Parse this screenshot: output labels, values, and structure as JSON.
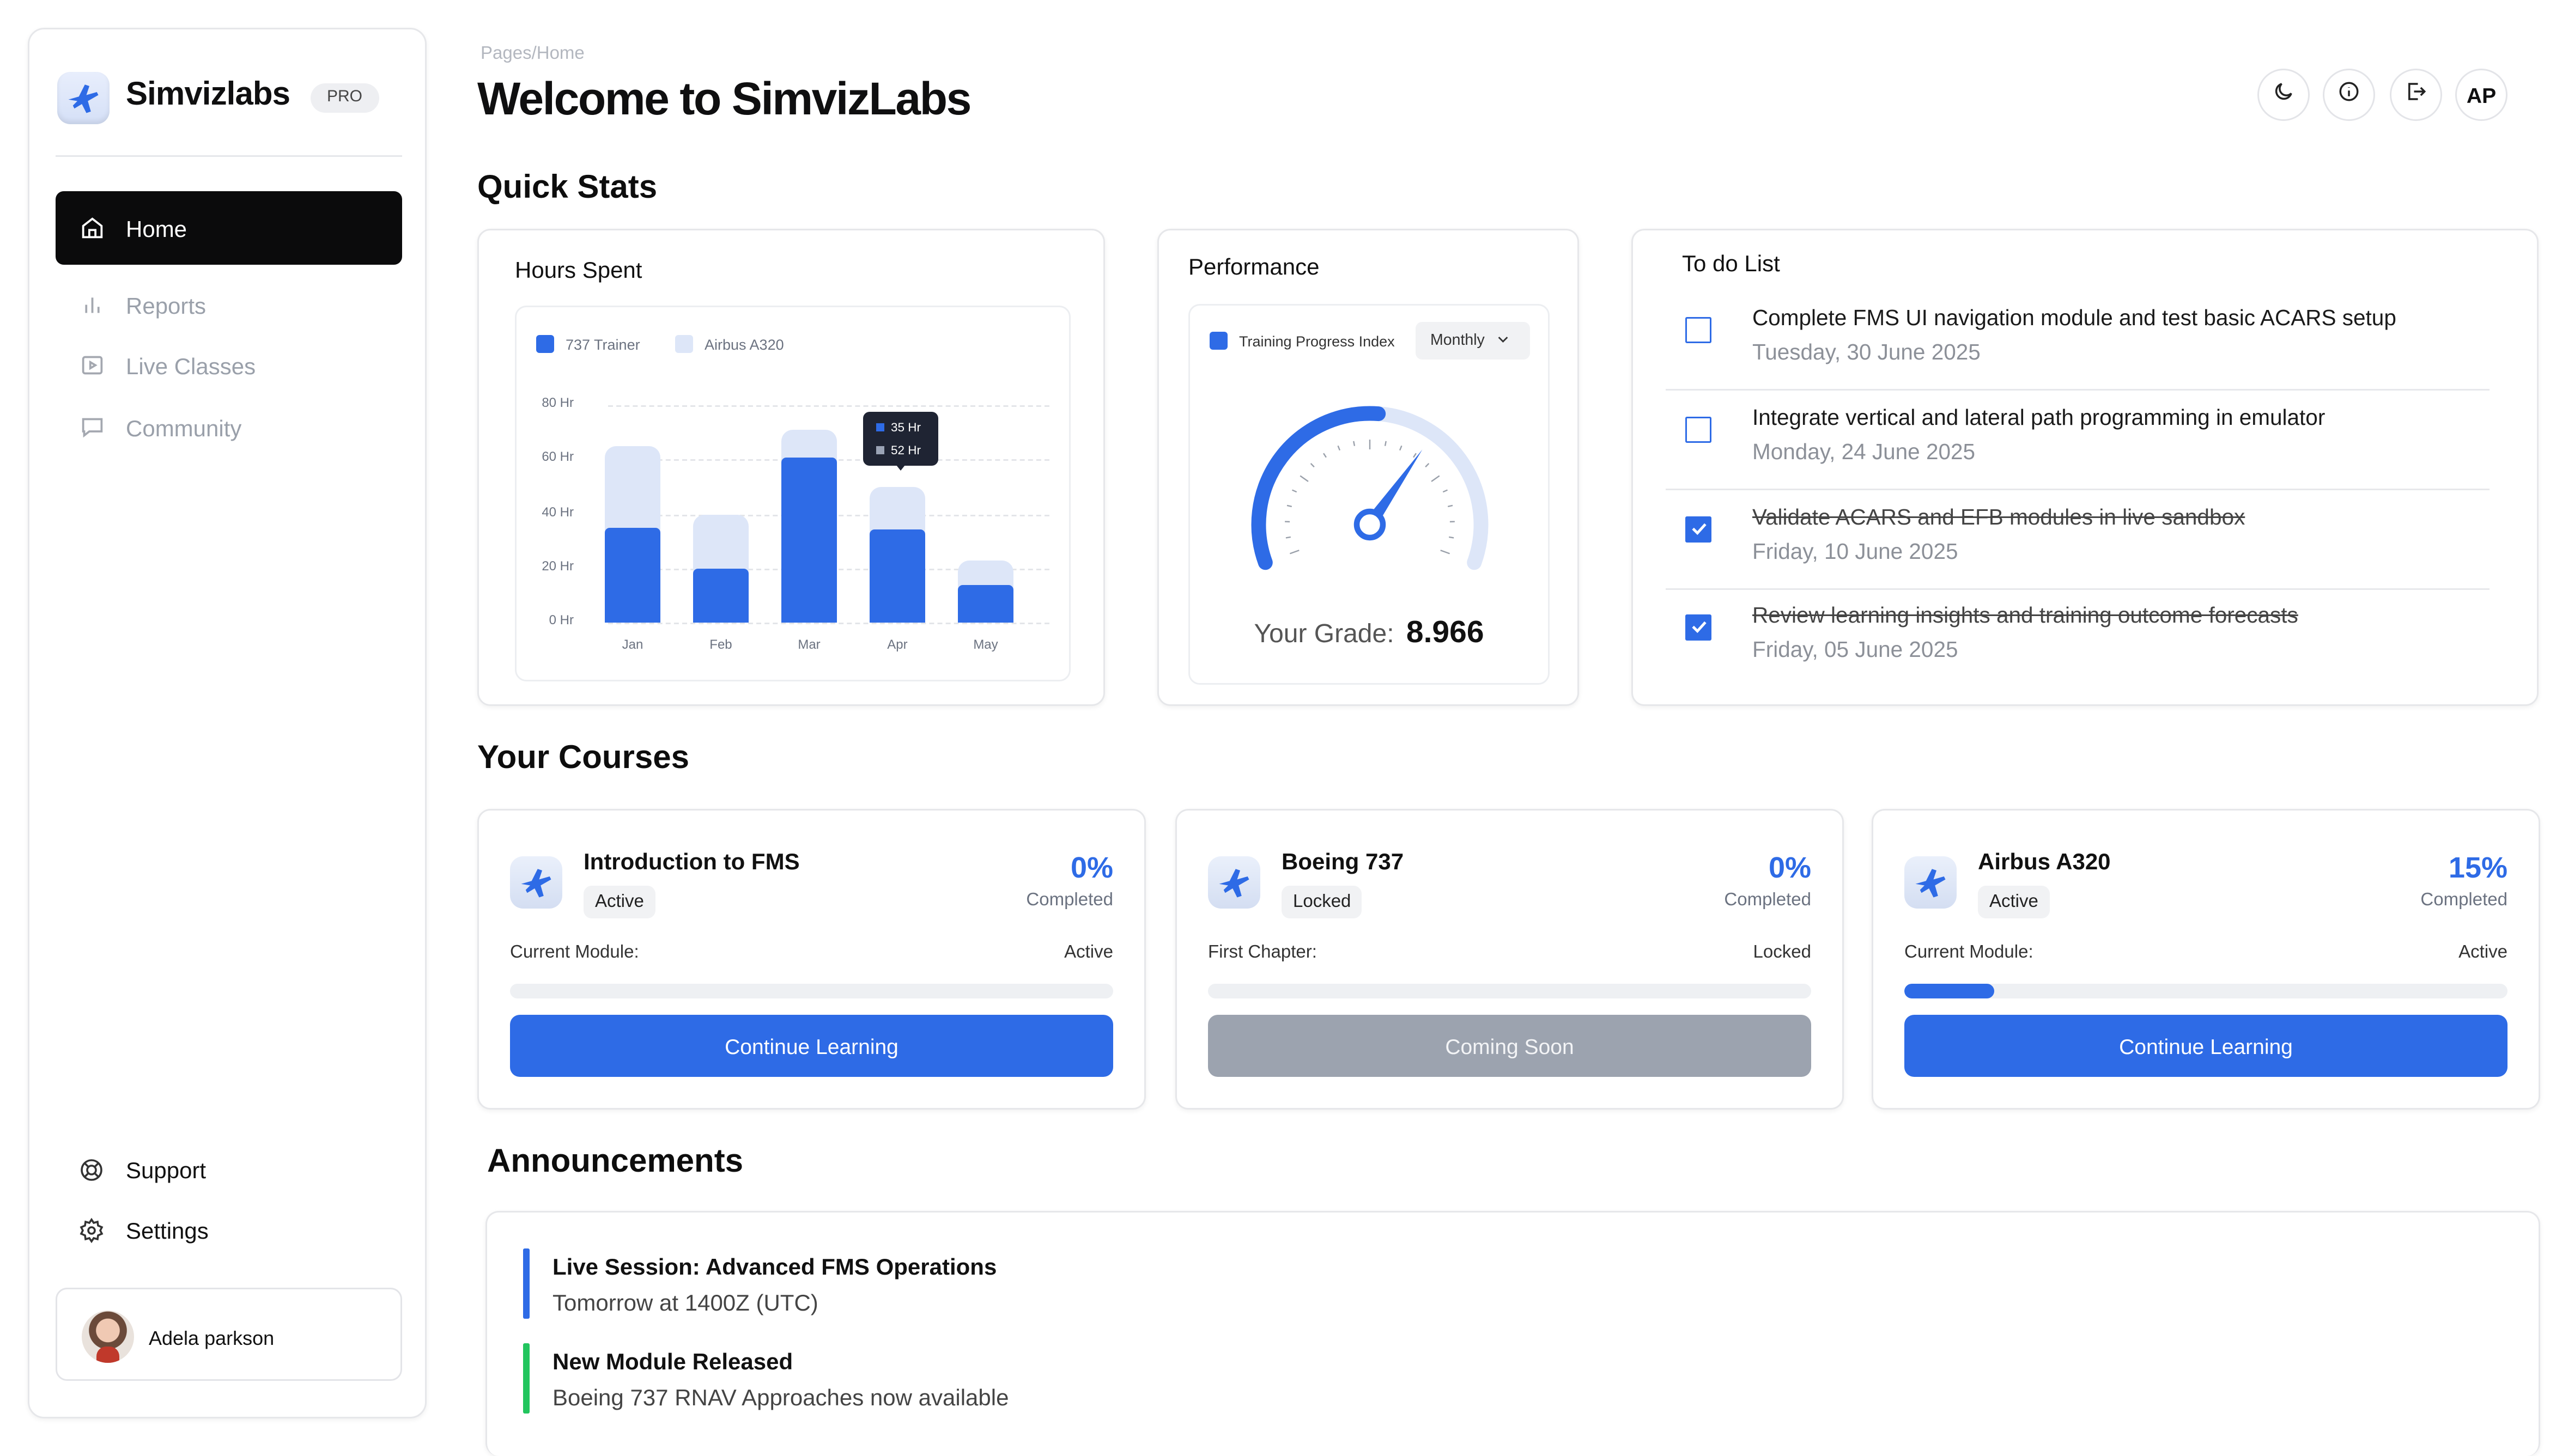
{
  "brand": {
    "name": "Simvizlabs",
    "badge": "PRO"
  },
  "sidebar": {
    "items": [
      {
        "label": "Home",
        "icon": "home-icon",
        "active": true
      },
      {
        "label": "Reports",
        "icon": "bar-chart-icon"
      },
      {
        "label": "Live Classes",
        "icon": "play-video-icon"
      },
      {
        "label": "Community",
        "icon": "chat-icon"
      }
    ],
    "bottom": [
      {
        "label": "Support",
        "icon": "lifebuoy-icon"
      },
      {
        "label": "Settings",
        "icon": "gear-icon"
      }
    ],
    "user": {
      "name": "Adela parkson"
    }
  },
  "header": {
    "breadcrumb": "Pages/Home",
    "title": "Welcome to SimvizLabs",
    "actions": [
      "moon-icon",
      "info-icon",
      "logout-icon"
    ],
    "avatar_initials": "AP"
  },
  "quick_stats": {
    "heading": "Quick Stats",
    "hours_spent": {
      "title": "Hours Spent",
      "tooltip": [
        "35 Hr",
        "52 Hr"
      ]
    },
    "performance": {
      "title": "Performance",
      "legend": "Training Progress Index",
      "period": "Monthly",
      "grade_label": "Your Grade:",
      "grade_value": "8.966",
      "gauge_fraction": 0.52
    },
    "todo": {
      "title": "To do List",
      "items": [
        {
          "title": "Complete FMS UI navigation module and test basic ACARS setup",
          "date": "Tuesday, 30 June 2025",
          "done": false
        },
        {
          "title": "Integrate vertical and lateral path programming in emulator",
          "date": "Monday, 24 June 2025",
          "done": false
        },
        {
          "title": "Validate ACARS and EFB modules in live sandbox",
          "date": "Friday, 10 June 2025",
          "done": true
        },
        {
          "title": "Review learning insights and training outcome forecasts",
          "date": "Friday, 05 June 2025",
          "done": true
        }
      ]
    }
  },
  "chart_data": {
    "type": "bar",
    "categories": [
      "Jan",
      "Feb",
      "Mar",
      "Apr",
      "May"
    ],
    "series": [
      {
        "name": "737 Trainer",
        "values": [
          35,
          20,
          61,
          34,
          14
        ]
      },
      {
        "name": "Airbus A320",
        "values": [
          65,
          40,
          71,
          50,
          23
        ]
      }
    ],
    "y_ticks": [
      "80 Hr",
      "60 Hr",
      "40 Hr",
      "20 Hr",
      "0 Hr"
    ],
    "ylim": [
      0,
      80
    ],
    "grid": true,
    "legend_position": "top-left",
    "colors": {
      "737 Trainer": "#2e6be6",
      "Airbus A320": "#dde6f8"
    }
  },
  "courses": {
    "heading": "Your Courses",
    "items": [
      {
        "title": "Introduction to FMS",
        "status": "Active",
        "percent": "0%",
        "percent_label": "Completed",
        "module_label": "Current Module:",
        "module_state": "Active",
        "progress": 0,
        "cta": "Continue Learning",
        "cta_enabled": true
      },
      {
        "title": "Boeing 737",
        "status": "Locked",
        "percent": "0%",
        "percent_label": "Completed",
        "module_label": "First Chapter:",
        "module_state": "Locked",
        "progress": 0,
        "cta": "Coming Soon",
        "cta_enabled": false
      },
      {
        "title": "Airbus A320",
        "status": "Active",
        "percent": "15%",
        "percent_label": "Completed",
        "module_label": "Current Module:",
        "module_state": "Active",
        "progress": 0.15,
        "cta": "Continue Learning",
        "cta_enabled": true
      }
    ]
  },
  "announcements": {
    "heading": "Announcements",
    "items": [
      {
        "title": "Live Session: Advanced FMS Operations",
        "body": "Tomorrow at 1400Z (UTC)",
        "color": "#2e6be6"
      },
      {
        "title": "New Module Released",
        "body": "Boeing 737 RNAV Approaches now available",
        "color": "#22c55e"
      }
    ]
  },
  "colors": {
    "accent": "#2e6be6",
    "accent_light": "#dde6f8",
    "success": "#22c55e",
    "dark": "#0b0b0c"
  }
}
